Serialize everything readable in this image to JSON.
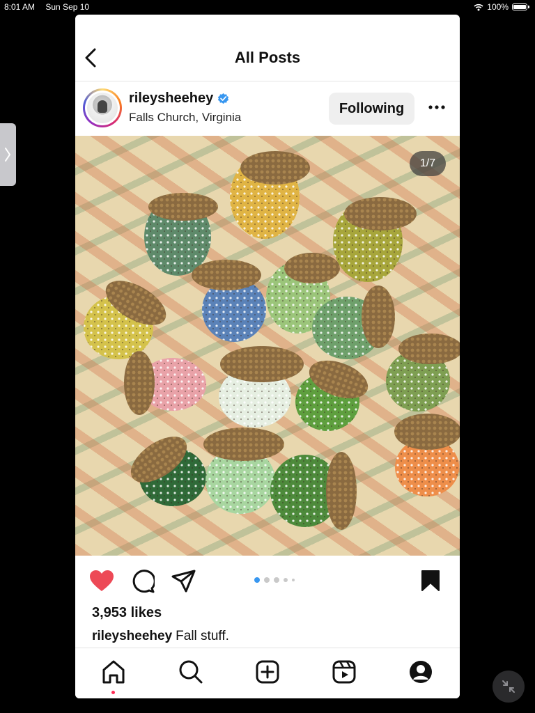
{
  "status_bar": {
    "time": "8:01 AM",
    "date": "Sun Sep 10",
    "battery": "100%"
  },
  "nav": {
    "title": "All Posts"
  },
  "post": {
    "username": "rileysheehey",
    "verified": true,
    "location": "Falls Church, Virginia",
    "follow_label": "Following",
    "image_counter": "1/7",
    "carousel": {
      "total_dots": 5,
      "active_index": 0
    },
    "likes": "3,953 likes",
    "caption_user": "rileysheehey",
    "caption_text": "Fall stuff.",
    "liked": true,
    "saved": true
  },
  "tabs": [
    "home",
    "search",
    "create",
    "reels",
    "profile"
  ],
  "colors": {
    "like_red": "#ed4956",
    "verified_blue": "#3897f0",
    "active_dot": "#ff2d55",
    "carousel_active": "#3897f0"
  }
}
